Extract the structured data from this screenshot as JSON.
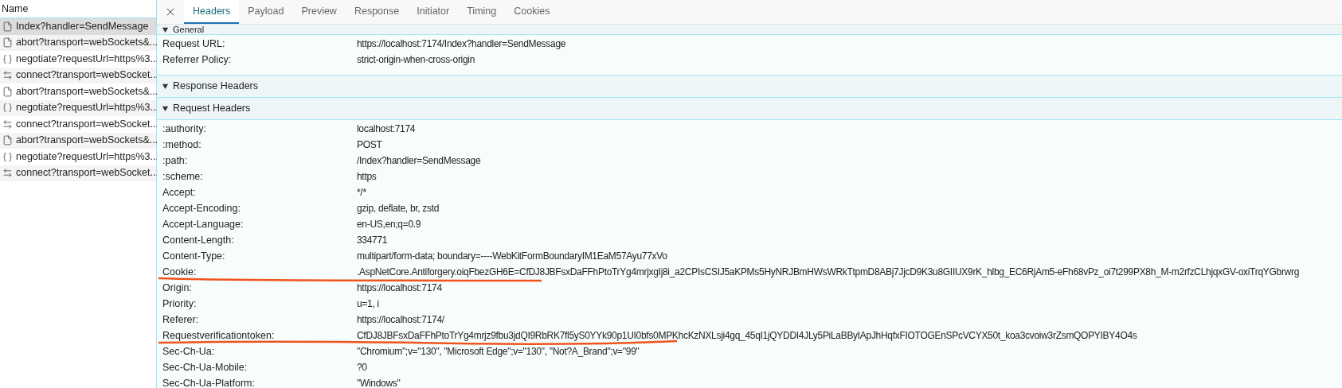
{
  "request_list": {
    "header": "Name",
    "items": [
      {
        "kind": "document",
        "name": "Index?handler=SendMessage",
        "selected": true
      },
      {
        "kind": "document",
        "name": "abort?transport=webSockets&...",
        "selected": false
      },
      {
        "kind": "fetch",
        "name": "negotiate?requestUrl=https%3...",
        "selected": false
      },
      {
        "kind": "websocket",
        "name": "connect?transport=webSocket...",
        "selected": false
      },
      {
        "kind": "document",
        "name": "abort?transport=webSockets&...",
        "selected": false
      },
      {
        "kind": "fetch",
        "name": "negotiate?requestUrl=https%3...",
        "selected": false
      },
      {
        "kind": "websocket",
        "name": "connect?transport=webSocket...",
        "selected": false
      },
      {
        "kind": "document",
        "name": "abort?transport=webSockets&...",
        "selected": false
      },
      {
        "kind": "fetch",
        "name": "negotiate?requestUrl=https%3...",
        "selected": false
      },
      {
        "kind": "websocket",
        "name": "connect?transport=webSocket...",
        "selected": false
      }
    ]
  },
  "tabs": [
    {
      "label": "Headers",
      "selected": true
    },
    {
      "label": "Payload",
      "selected": false
    },
    {
      "label": "Preview",
      "selected": false
    },
    {
      "label": "Response",
      "selected": false
    },
    {
      "label": "Initiator",
      "selected": false
    },
    {
      "label": "Timing",
      "selected": false
    },
    {
      "label": "Cookies",
      "selected": false
    }
  ],
  "sections": [
    {
      "title": "General",
      "expanded": true,
      "rows": [
        {
          "key": "Request URL:",
          "value": "https://localhost:7174/Index?handler=SendMessage"
        },
        {
          "key": "Referrer Policy:",
          "value": "strict-origin-when-cross-origin"
        }
      ]
    },
    {
      "title": "Response Headers",
      "expanded": true
    },
    {
      "title": "Request Headers",
      "expanded": true,
      "rows": [
        {
          "key": ":authority:",
          "value": "localhost:7174"
        },
        {
          "key": ":method:",
          "value": "POST"
        },
        {
          "key": ":path:",
          "value": "/Index?handler=SendMessage"
        },
        {
          "key": ":scheme:",
          "value": "https"
        },
        {
          "key": "Accept:",
          "value": "*/*"
        },
        {
          "key": "Accept-Encoding:",
          "value": "gzip, deflate, br, zstd"
        },
        {
          "key": "Accept-Language:",
          "value": "en-US,en;q=0.9"
        },
        {
          "key": "Content-Length:",
          "value": "334771"
        },
        {
          "key": "Content-Type:",
          "value": "multipart/form-data; boundary=----WebKitFormBoundaryIM1EaM57Ayu77xVo"
        },
        {
          "key": "Cookie:",
          "value": ".AspNetCore.Antiforgery.oiqFbezGH6E=CfDJ8JBFsxDaFFhPtoTrYg4mrjxgIj8i_a2CPIsCSIJ5aKPMs5HyNRJBmHWsWRkTtpmD8ABj7JjcD9K3u8GIIUX9rK_hlbg_EC6RjAm5-eFh68vPz_oi7t299PX8h_M-m2rfzCLhjqxGV-oxiTrqYGbrwrg"
        },
        {
          "key": "Origin:",
          "value": "https://localhost:7174"
        },
        {
          "key": "Priority:",
          "value": "u=1, i"
        },
        {
          "key": "Referer:",
          "value": "https://localhost:7174/"
        },
        {
          "key": "Requestverificationtoken:",
          "value": "CfDJ8JBFsxDaFFhPtoTrYg4mrjz9fbu3jdQI9RbRK7fl5yS0YYk90p1UI0bfs0MPKhcKzNXLsji4gq_45qI1jQYDDI4JLy5PiLaBByIApJhHqfxFIOTOGEnSPcVCYX50t_koa3cvoiw3rZsmQOPYIBY4O4s"
        },
        {
          "key": "Sec-Ch-Ua:",
          "value": "\"Chromium\";v=\"130\", \"Microsoft Edge\";v=\"130\", \"Not?A_Brand\";v=\"99\""
        },
        {
          "key": "Sec-Ch-Ua-Mobile:",
          "value": "?0"
        },
        {
          "key": "Sec-Ch-Ua-Platform:",
          "value": "\"Windows\""
        }
      ]
    }
  ]
}
